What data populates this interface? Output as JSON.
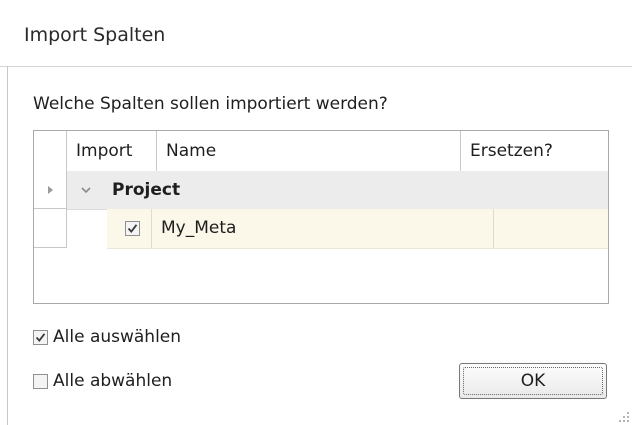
{
  "window": {
    "title": "Import Spalten"
  },
  "prompt": "Welche Spalten sollen importiert werden?",
  "grid": {
    "columns": [
      "Import",
      "Name",
      "Ersetzen?"
    ],
    "group": {
      "label": "Project",
      "expanded": true,
      "icon": "chevron-down-icon"
    },
    "rows": [
      {
        "checked": true,
        "name": "My_Meta",
        "replace": ""
      }
    ],
    "row_indicator_icon": "row-pointer-icon"
  },
  "options": {
    "select_all": {
      "label": "Alle auswählen",
      "checked": true
    },
    "deselect_all": {
      "label": "Alle abwählen",
      "checked": false
    }
  },
  "buttons": {
    "ok_label": "OK"
  },
  "colors": {
    "group_row_bg": "#ececec",
    "data_row_bg": "#fbf8ea",
    "border": "#a9a9a9"
  }
}
